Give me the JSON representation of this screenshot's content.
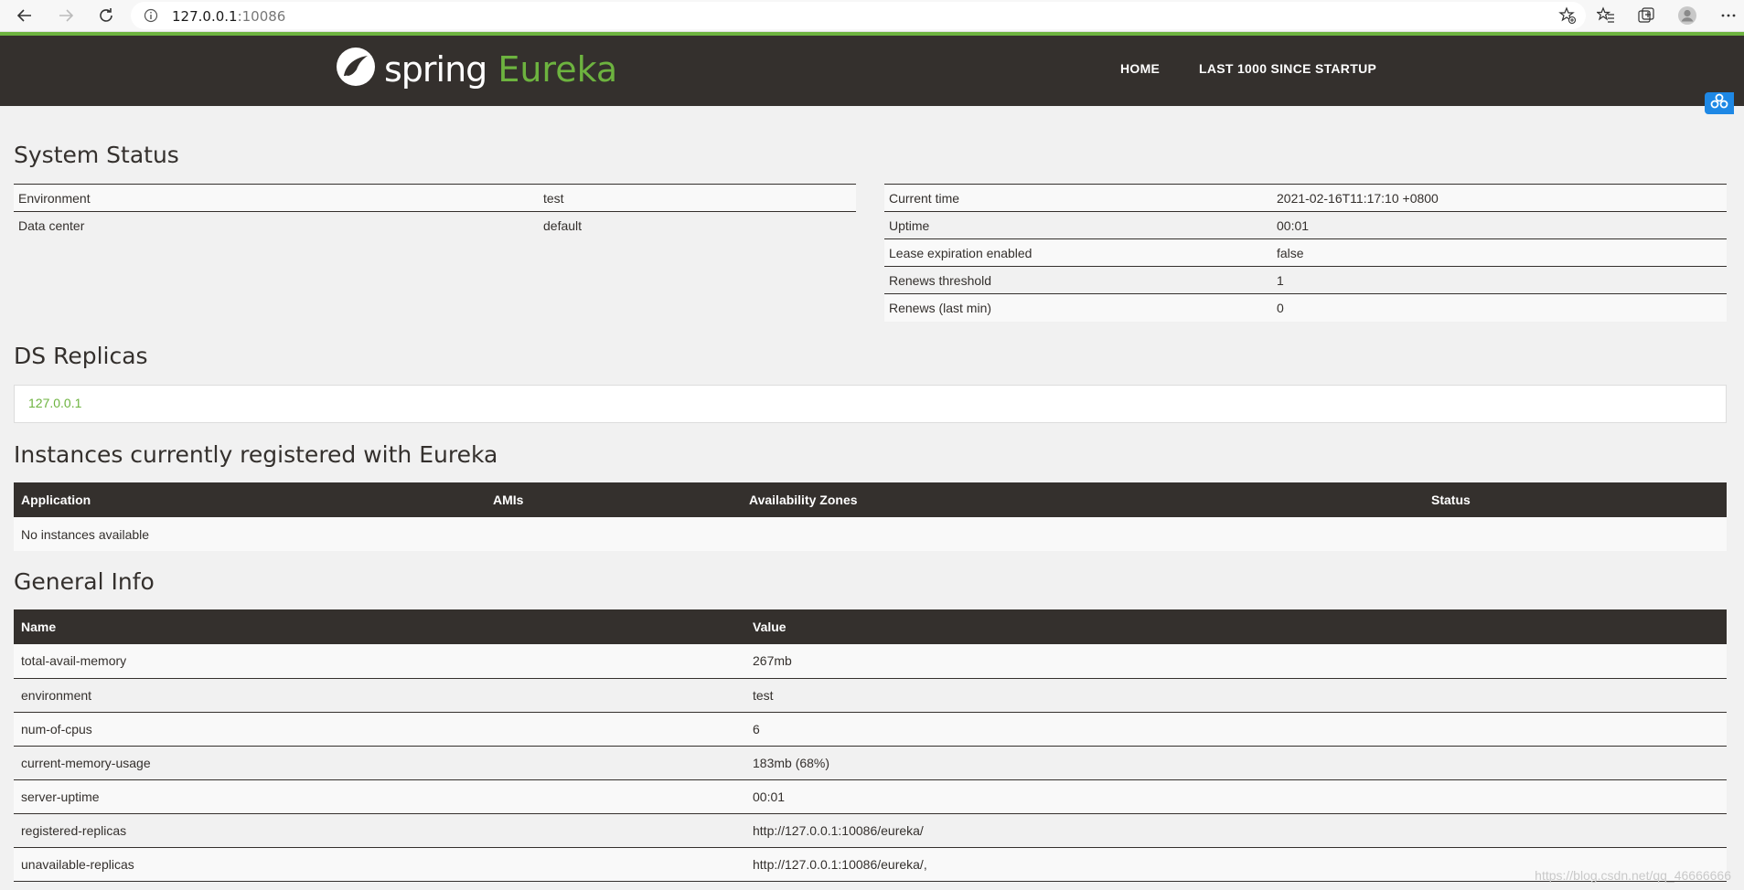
{
  "browser": {
    "url_host": "127.0.0.1",
    "url_port": ":10086"
  },
  "navbar": {
    "logo_spring": "spring",
    "logo_eureka": "Eureka",
    "home_label": "HOME",
    "last1000_label": "LAST 1000 SINCE STARTUP"
  },
  "system_status": {
    "title": "System Status",
    "left": [
      {
        "name": "Environment",
        "value": "test"
      },
      {
        "name": "Data center",
        "value": "default"
      }
    ],
    "right": [
      {
        "name": "Current time",
        "value": "2021-02-16T11:17:10 +0800"
      },
      {
        "name": "Uptime",
        "value": "00:01"
      },
      {
        "name": "Lease expiration enabled",
        "value": "false"
      },
      {
        "name": "Renews threshold",
        "value": "1"
      },
      {
        "name": "Renews (last min)",
        "value": "0"
      }
    ]
  },
  "ds_replicas": {
    "title": "DS Replicas",
    "replica": "127.0.0.1"
  },
  "instances": {
    "title": "Instances currently registered with Eureka",
    "columns": [
      "Application",
      "AMIs",
      "Availability Zones",
      "Status"
    ],
    "empty_text": "No instances available"
  },
  "general_info": {
    "title": "General Info",
    "columns": [
      "Name",
      "Value"
    ],
    "rows": [
      {
        "name": "total-avail-memory",
        "value": "267mb"
      },
      {
        "name": "environment",
        "value": "test"
      },
      {
        "name": "num-of-cpus",
        "value": "6"
      },
      {
        "name": "current-memory-usage",
        "value": "183mb (68%)"
      },
      {
        "name": "server-uptime",
        "value": "00:01"
      },
      {
        "name": "registered-replicas",
        "value": "http://127.0.0.1:10086/eureka/"
      },
      {
        "name": "unavailable-replicas",
        "value": "http://127.0.0.1:10086/eureka/,"
      }
    ]
  },
  "watermark": "https://blog.csdn.net/qq_46666666",
  "colors": {
    "brand_green": "#6db33f",
    "navbar_dark": "#34302d",
    "page_bg": "#f1f1f1"
  }
}
